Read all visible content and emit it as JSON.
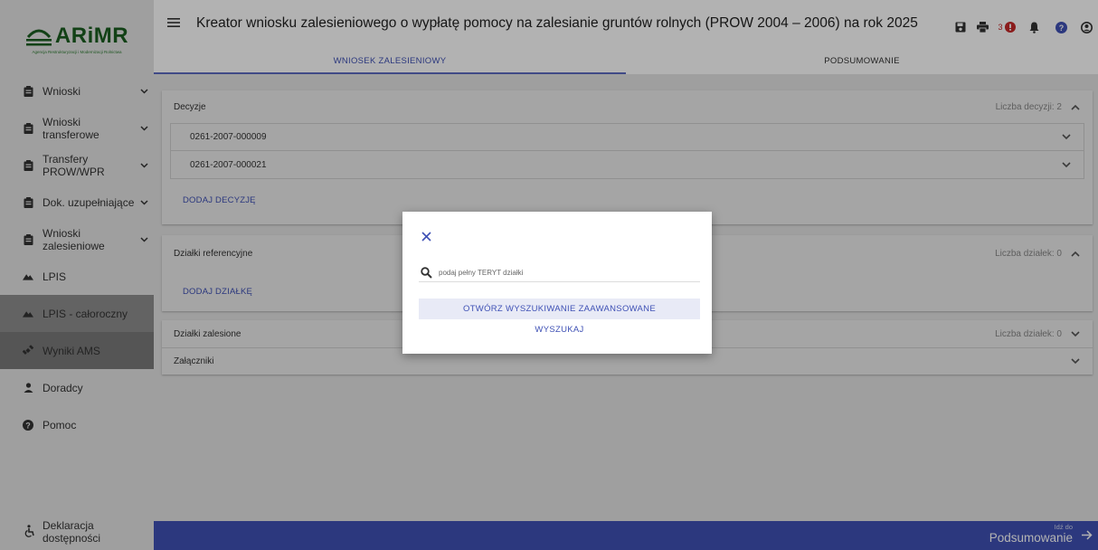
{
  "logo": {
    "name": "ARiMR",
    "subtitle": "Agencja Restrukturyzacji i Modernizacji Rolnictwa"
  },
  "sidebar": {
    "items": [
      {
        "label": "Wnioski",
        "icon": "clipboard-icon",
        "has_chevron": true
      },
      {
        "label": "Wnioski transferowe",
        "icon": "clipboard-icon",
        "has_chevron": true
      },
      {
        "label": "Transfery PROW/WPR",
        "icon": "clipboard-icon",
        "has_chevron": true
      },
      {
        "label": "Dok. uzupełniające",
        "icon": "clipboard-icon",
        "has_chevron": true
      },
      {
        "label": "Wnioski zalesieniowe",
        "icon": "clipboard-icon",
        "has_chevron": true
      },
      {
        "label": "LPIS",
        "icon": "mountain-icon",
        "has_chevron": false
      },
      {
        "label": "LPIS - całoroczny",
        "icon": "mountain-icon",
        "has_chevron": false
      },
      {
        "label": "Wyniki AMS",
        "icon": "satellite-icon",
        "has_chevron": false
      },
      {
        "label": "Doradcy",
        "icon": "person-icon",
        "has_chevron": false
      },
      {
        "label": "Pomoc",
        "icon": "help-icon",
        "has_chevron": false
      }
    ],
    "bottom": {
      "label": "Deklaracja dostępności",
      "icon": "accessibility-icon"
    }
  },
  "header": {
    "title": "Kreator wniosku zalesieniowego o wypłatę pomocy na zalesianie gruntów rolnych (PROW 2004 – 2006) na rok 2025",
    "alert_count": "3",
    "icons": [
      "save-icon",
      "print-icon",
      "alert-icon",
      "bell-icon",
      "help-icon",
      "account-icon"
    ]
  },
  "tabs": [
    {
      "label": "WNIOSEK ZALESIENIOWY",
      "active": true
    },
    {
      "label": "PODSUMOWANIE",
      "active": false
    }
  ],
  "sections": {
    "decyzje": {
      "title": "Decyzje",
      "count_label": "Liczba decyzji: 2",
      "rows": [
        "0261-2007-000009",
        "0261-2007-000021"
      ],
      "add_label": "DODAJ DECYZJĘ"
    },
    "dzialki_ref": {
      "title": "Działki referencyjne",
      "count_label": "Liczba działek: 0",
      "add_label": "DODAJ DZIAŁKĘ"
    },
    "dzialki_zal": {
      "title": "Działki zalesione",
      "count_label": "Liczba działek: 0"
    },
    "zalaczniki": {
      "title": "Załączniki"
    }
  },
  "footer": {
    "small": "Idź do",
    "big": "Podsumowanie"
  },
  "dialog": {
    "search_placeholder": "podaj pełny TERYT działki",
    "search_value": "",
    "advanced_label": "OTWÓRZ WYSZUKIWANIE ZAAWANSOWANE",
    "search_label": "WYSZUKAJ"
  },
  "colors": {
    "primary": "#3f51b5",
    "sidebar_bg": "#e4e4e4",
    "active_nav": "#8e8e8e",
    "alert": "#c62828",
    "logo_green": "#1b5e20"
  }
}
